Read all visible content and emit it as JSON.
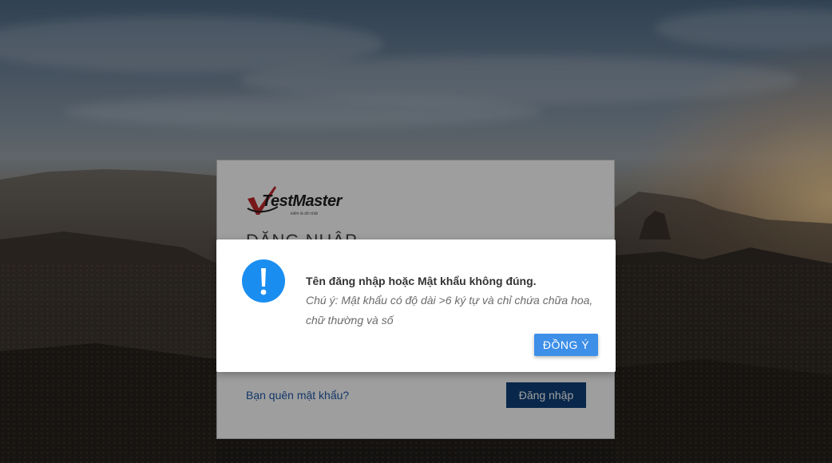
{
  "login": {
    "logo_text": "TestMaster",
    "logo_tagline": "kiểm là tốt nhất",
    "title": "ĐĂNG NHẬP",
    "forgot_password": "Bạn quên mật khẩu?",
    "submit_label": "Đăng nhập"
  },
  "alert": {
    "title": "Tên đăng nhập hoặc Mật khẩu không đúng.",
    "message": "Chú ý: Mật khẩu có độ dài >6 ký tự và chỉ chứa chữa hoa, chữ thường và số",
    "confirm_label": "ĐỒNG Ý"
  },
  "colors": {
    "alert_icon": "#1a8ef0",
    "confirm_button": "#3d8fe8",
    "login_button": "#0d3f7a",
    "link": "#1f5aa8"
  },
  "icons": {
    "alert": "exclamation-circle-icon",
    "logo_check": "checkmark-logo-icon"
  }
}
